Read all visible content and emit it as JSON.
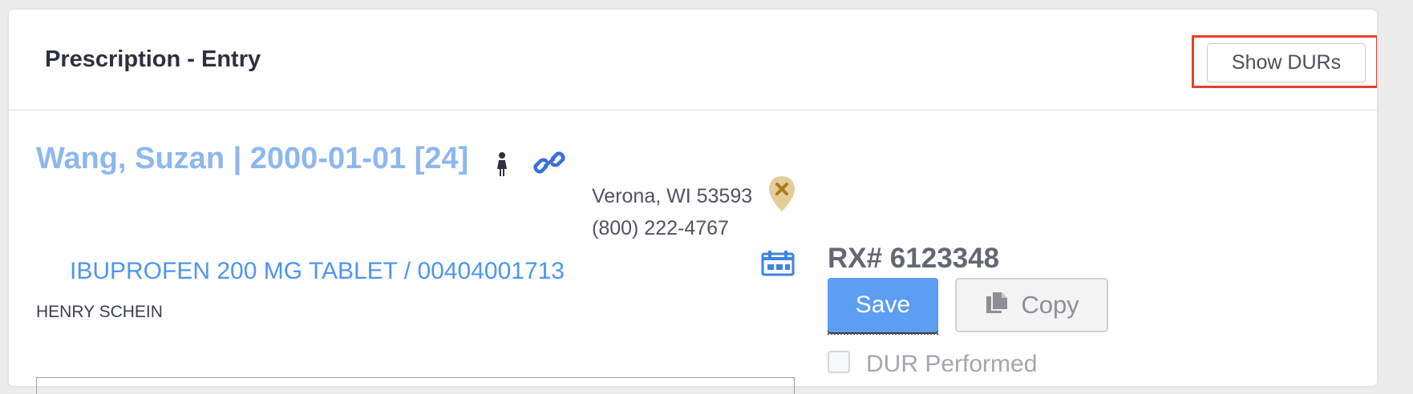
{
  "header": {
    "title": "Prescription - Entry",
    "show_durs_label": "Show DURs",
    "highlight_color": "#e0432d"
  },
  "patient": {
    "name_dob_age": "Wang, Suzan | 2000-01-01 [24]",
    "gender_icon": "female-person-icon",
    "link_icon": "link-icon",
    "address_line": "Verona, WI 53593",
    "phone": "(800) 222-4767",
    "address_icon": "map-pin-x-icon"
  },
  "drug": {
    "name_ndc": "IBUPROFEN 200 MG TABLET / 00404001713",
    "manufacturer": "HENRY SCHEIN",
    "schedule_icon": "calendar-icon"
  },
  "rx": {
    "number": "RX# 6123348",
    "save_label": "Save",
    "copy_label": "Copy",
    "dur_performed_label": "DUR Performed",
    "dur_performed_checked": false
  },
  "colors": {
    "accent": "#5c9ef3",
    "patient_link": "#8db7ee",
    "drug_link": "#4e95f0",
    "title": "#2c3040"
  }
}
